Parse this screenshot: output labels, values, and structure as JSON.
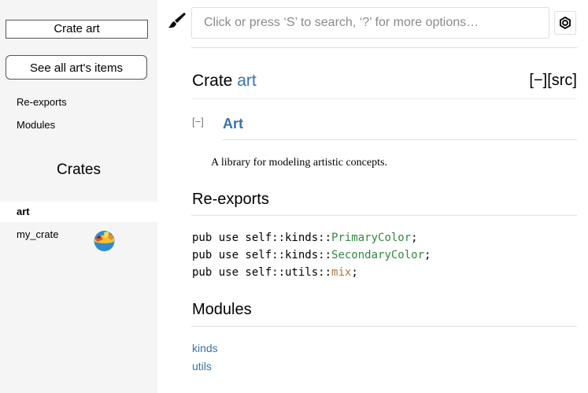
{
  "sidebar": {
    "crate_title": "Crate art",
    "all_items_button": "See all art's items",
    "links": [
      "Re-exports",
      "Modules"
    ],
    "crates_heading": "Crates",
    "crates": [
      {
        "name": "art",
        "active": true
      },
      {
        "name": "my_crate",
        "active": false
      }
    ]
  },
  "search": {
    "placeholder": "Click or press ‘S’ to search, ‘?’ for more options…"
  },
  "main": {
    "title_prefix": "Crate ",
    "title_crate": "art",
    "title_links": "[−][src]",
    "collapse_toggle": "[−]",
    "doc_heading": "Art",
    "doc_text": "A library for modeling artistic concepts.",
    "reexports_heading": "Re-exports",
    "reexports": [
      {
        "prefix": "pub use self::kinds::",
        "name": "PrimaryColor",
        "kind": "struct"
      },
      {
        "prefix": "pub use self::kinds::",
        "name": "SecondaryColor",
        "kind": "struct"
      },
      {
        "prefix": "pub use self::utils::",
        "name": "mix",
        "kind": "fn"
      }
    ],
    "modules_heading": "Modules",
    "modules": [
      "kinds",
      "utils"
    ]
  },
  "colors": {
    "link": "#3873ad",
    "struct": "#2f8a3c",
    "fn": "#ad7c37",
    "sidebar_bg": "#f5f5f5"
  }
}
